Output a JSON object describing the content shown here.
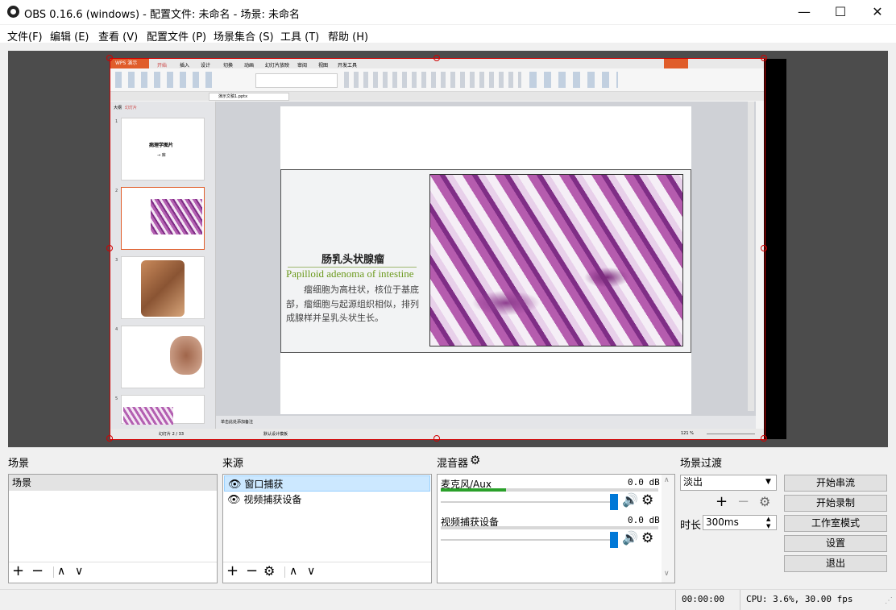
{
  "window": {
    "title": "OBS 0.16.6 (windows) - 配置文件: 未命名 - 场景: 未命名",
    "minimize_glyph": "—",
    "maximize_glyph": "☐",
    "close_glyph": "✕"
  },
  "menu": [
    "文件(F)",
    "编辑 (E)",
    "查看 (V)",
    "配置文件 (P)",
    "场景集合 (S)",
    "工具 (T)",
    "帮助 (H)"
  ],
  "capture": {
    "wps_brand": "WPS 演示",
    "ribbon_tabs": [
      "开始",
      "插入",
      "设计",
      "切换",
      "动画",
      "幻灯片放映",
      "审阅",
      "视图",
      "开发工具"
    ],
    "doc_tab": "演示文稿1.pptx",
    "thumbs_panel_tabs": [
      "大纲",
      "幻灯片"
    ],
    "thumb_numbers": [
      "1",
      "2",
      "3",
      "4",
      "5"
    ],
    "thumb1_title": "病理学图片",
    "thumb1_sub": "→ 库",
    "status_left": "幻灯片 2 / 33",
    "status_mid": "默认设计模板",
    "status_zoom": "121 %",
    "notes_hint": "单击此处添加备注",
    "slide": {
      "title_cn": "肠乳头状腺瘤",
      "title_en": "Papilloid adenoma of intestine",
      "body": "瘤细胞为高柱状，核位于基底部，瘤细胞与起源组织相似，排列成腺样并呈乳头状生长。"
    }
  },
  "docks": {
    "scenes": {
      "title": "场景",
      "items": [
        "场景"
      ]
    },
    "sources": {
      "title": "来源",
      "items": [
        {
          "label": "窗口捕获",
          "visible": true,
          "selected": true
        },
        {
          "label": "视频捕获设备",
          "visible": true,
          "selected": false
        }
      ]
    },
    "mixer": {
      "title": "混音器",
      "channels": [
        {
          "name": "麦克风/Aux",
          "db": "0.0 dB",
          "level": 0.3,
          "volume": 1.0
        },
        {
          "name": "视频捕获设备",
          "db": "0.0 dB",
          "level": 0.0,
          "volume": 1.0
        }
      ]
    },
    "transitions": {
      "title": "场景过渡",
      "selected": "淡出",
      "duration_label": "时长",
      "duration_value": "300ms"
    }
  },
  "controls": [
    "开始串流",
    "开始录制",
    "工作室模式",
    "设置",
    "退出"
  ],
  "status": {
    "time": "00:00:00",
    "cpu": "CPU: 3.6%, 30.00 fps"
  },
  "colors": {
    "selection_red": "#d00000",
    "wps_orange": "#e05d2a",
    "accent_blue": "#0078d7",
    "meter_green": "#2aa02a"
  }
}
